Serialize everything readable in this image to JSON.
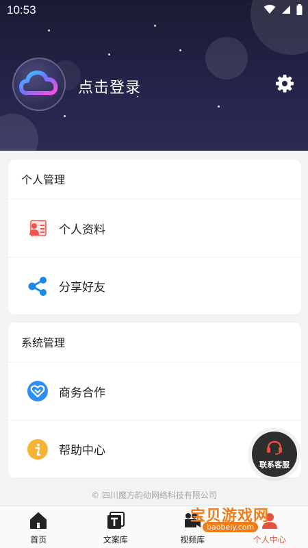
{
  "status": {
    "time": "10:53"
  },
  "header": {
    "login_text": "点击登录"
  },
  "personal_card": {
    "title": "个人管理",
    "items": [
      {
        "label": "个人资料",
        "icon": "profile-card-icon"
      },
      {
        "label": "分享好友",
        "icon": "share-icon"
      }
    ]
  },
  "system_card": {
    "title": "系统管理",
    "items": [
      {
        "label": "商务合作",
        "icon": "handshake-icon"
      },
      {
        "label": "帮助中心",
        "icon": "info-icon"
      }
    ]
  },
  "service": {
    "label": "联系客服"
  },
  "footer": {
    "copyright": "© 四川魔方韵动网络科技有限公司"
  },
  "nav": {
    "items": [
      {
        "label": "首页",
        "icon": "home-icon"
      },
      {
        "label": "文案库",
        "icon": "text-icon"
      },
      {
        "label": "视频库",
        "icon": "video-icon"
      },
      {
        "label": "个人中心",
        "icon": "user-icon",
        "active": true
      }
    ]
  },
  "watermark": {
    "title": "宝贝游戏网",
    "url": "baobeiy.com"
  },
  "colors": {
    "accent": "#e5533d",
    "header_bg": "#1b1a33",
    "share_blue": "#1e88e5",
    "info_yellow": "#f5b335"
  }
}
